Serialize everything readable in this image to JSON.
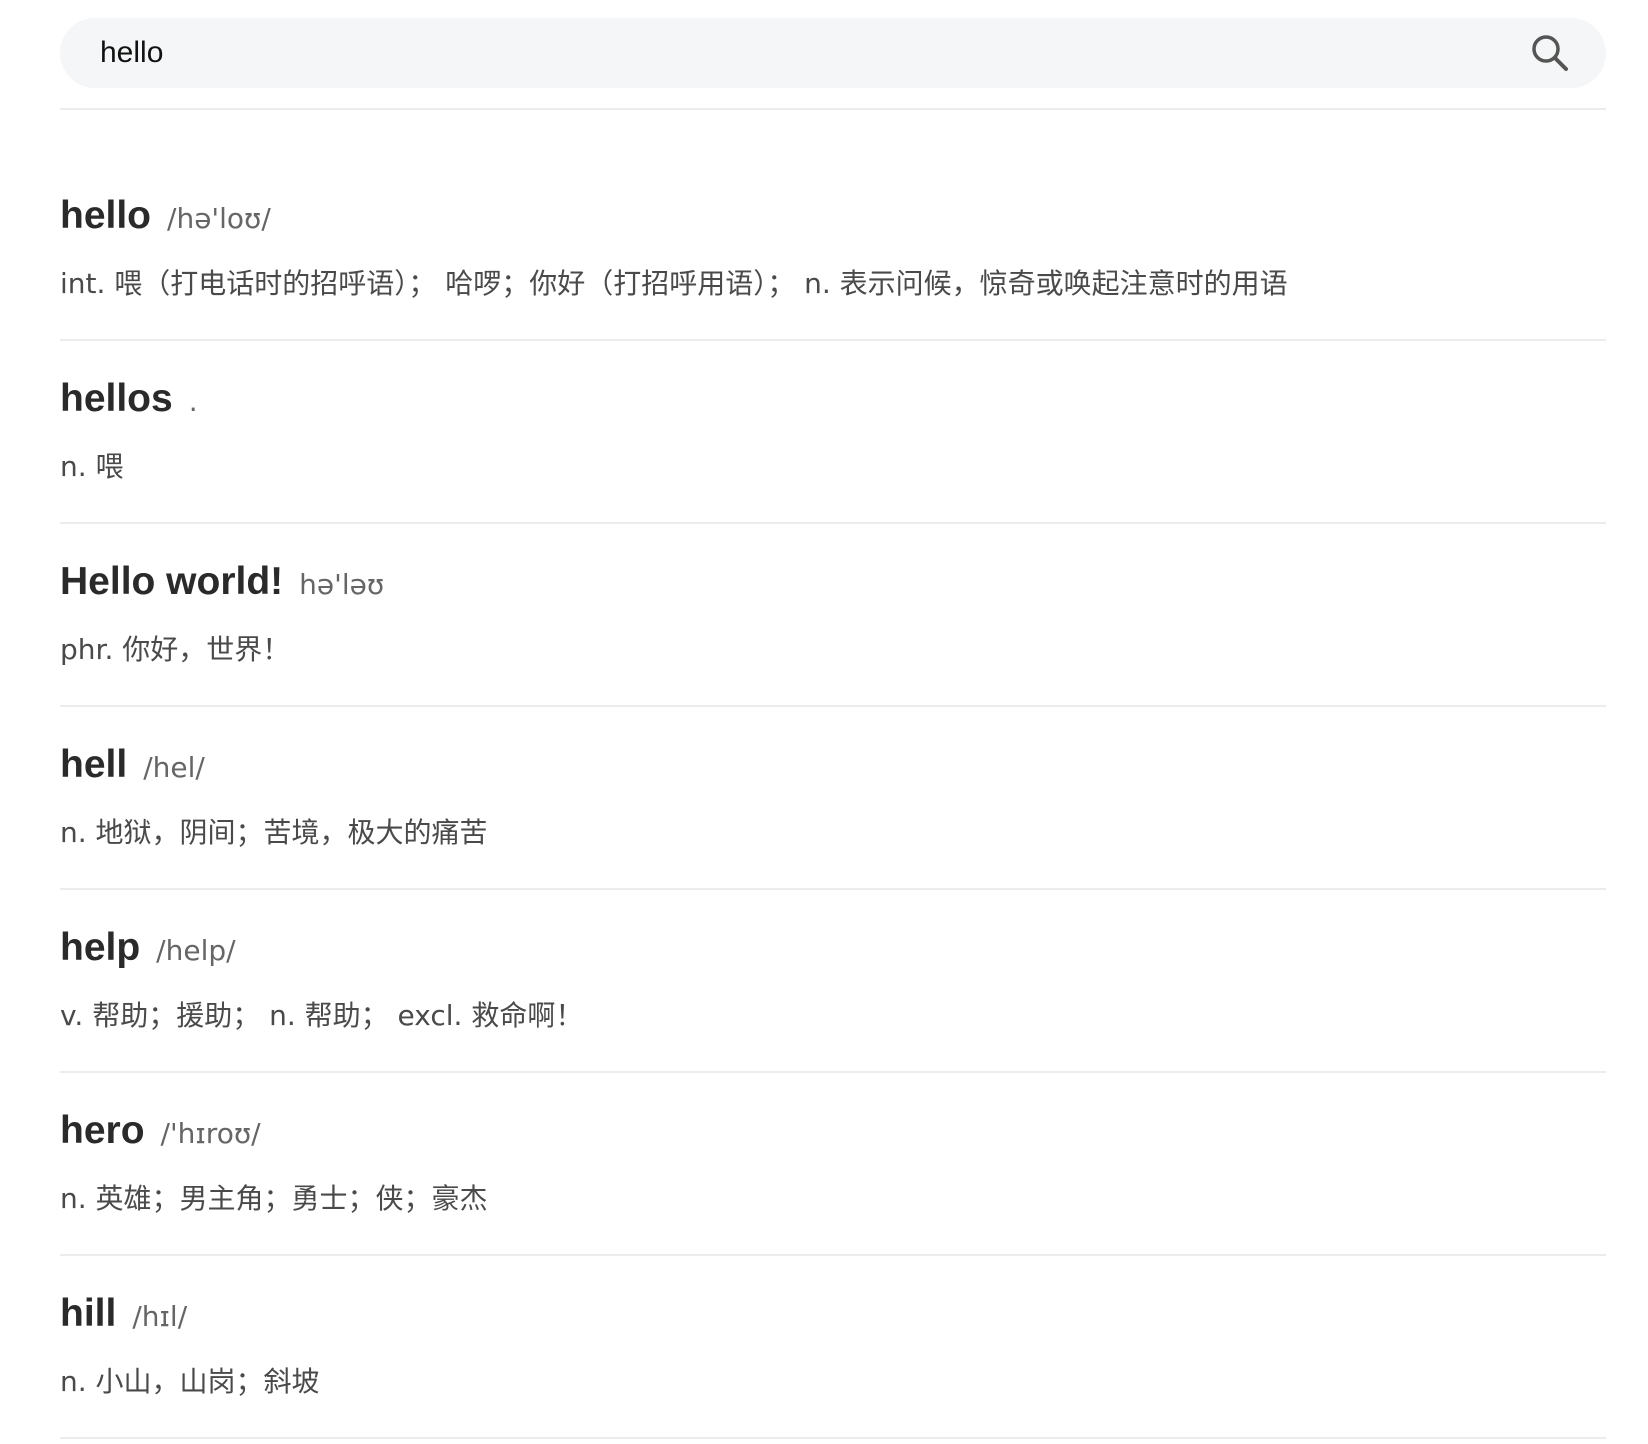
{
  "search": {
    "value": "hello",
    "icon": "search-icon"
  },
  "results": [
    {
      "word": "hello",
      "phonetic": "/hə'loʊ/",
      "definition": "int. 喂（打电话时的招呼语）； 哈啰；你好（打招呼用语）；  n. 表示问候，惊奇或唤起注意时的用语"
    },
    {
      "word": "hellos",
      "phonetic": ".",
      "definition": "n. 喂"
    },
    {
      "word": "Hello world!",
      "phonetic": "hə'ləʊ",
      "definition": "phr. 你好，世界！"
    },
    {
      "word": "hell",
      "phonetic": "/hel/",
      "definition": "n. 地狱，阴间；苦境，极大的痛苦"
    },
    {
      "word": "help",
      "phonetic": "/help/",
      "definition": "v. 帮助；援助；  n. 帮助；  excl. 救命啊！"
    },
    {
      "word": "hero",
      "phonetic": "/'hɪroʊ/",
      "definition": "n. 英雄；男主角；勇士；侠；豪杰"
    },
    {
      "word": "hill",
      "phonetic": "/hɪl/",
      "definition": "n. 小山，山岗；斜坡"
    }
  ]
}
